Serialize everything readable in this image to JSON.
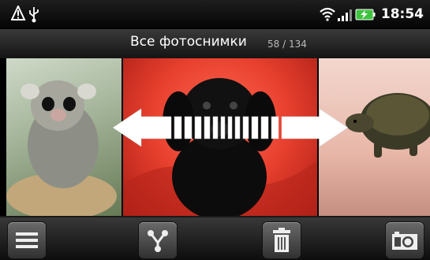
{
  "status_bar": {
    "time": "18:54",
    "icons": [
      "alert-icon",
      "usb-icon",
      "wifi-icon",
      "signal-icon",
      "battery-charging-icon"
    ],
    "battery_color": "#3fc33f"
  },
  "gallery": {
    "title": "Все фотоснимки",
    "counter": "58 / 134",
    "photos": [
      {
        "subject": "marmoset"
      },
      {
        "subject": "black puppy"
      },
      {
        "subject": "turtle"
      }
    ]
  },
  "overlay": {
    "icon": "swipe-left-right-arrows-icon"
  },
  "toolbar": {
    "buttons": [
      {
        "icon": "menu-icon"
      },
      {
        "icon": "share-icon"
      },
      {
        "icon": "trash-icon"
      },
      {
        "icon": "camera-icon"
      }
    ]
  }
}
